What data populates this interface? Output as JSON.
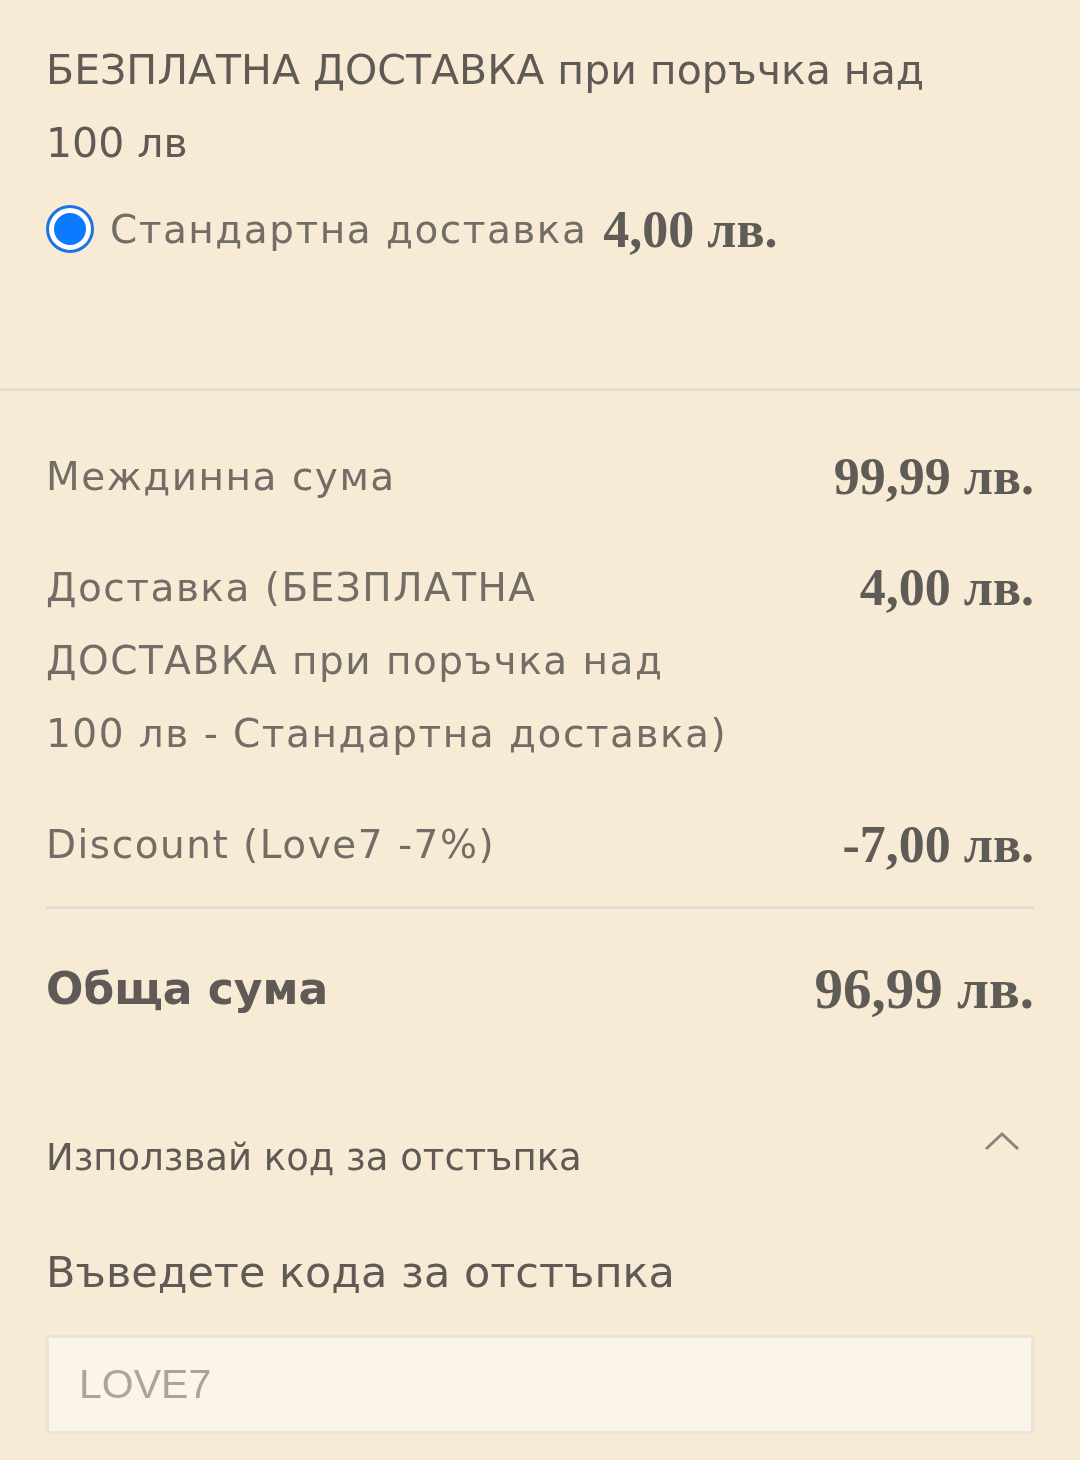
{
  "shipping": {
    "title": "БЕЗПЛАТНА ДОСТАВКА при поръчка над 100 лв",
    "options": [
      {
        "label": "Стандартна доставка",
        "price": "4,00 лв.",
        "selected": true
      }
    ]
  },
  "summary": {
    "rows": [
      {
        "label": "Междинна сума",
        "value": "99,99 лв."
      },
      {
        "label": "Доставка (БЕЗПЛАТНА ДОСТАВКА при поръчка над 100 лв - Стандартна доставка)",
        "value": "4,00 лв."
      },
      {
        "label": "Discount (Love7 -7%)",
        "value": "-7,00 лв."
      }
    ],
    "total": {
      "label": "Обща сума",
      "value": "96,99 лв."
    }
  },
  "coupon": {
    "toggle_label": "Използвай код за отстъпка",
    "expanded": true,
    "field_label": "Въведете кода за отстъпка",
    "placeholder": "LOVE7"
  }
}
